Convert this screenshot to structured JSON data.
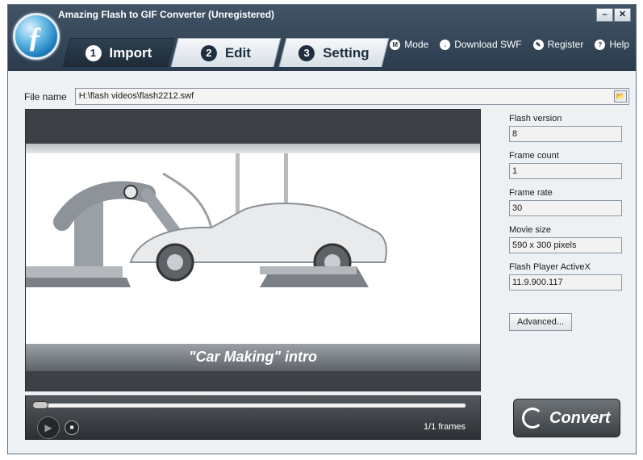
{
  "app": {
    "title": "Amazing Flash to GIF Converter (Unregistered)"
  },
  "window_buttons": {
    "minimize": "–",
    "close": "✕"
  },
  "tabs": [
    {
      "num": "1",
      "label": "Import"
    },
    {
      "num": "2",
      "label": "Edit"
    },
    {
      "num": "3",
      "label": "Setting"
    }
  ],
  "menu": [
    {
      "icon": "M",
      "label": "Mode"
    },
    {
      "icon": "↓",
      "label": "Download SWF"
    },
    {
      "icon": "✎",
      "label": "Register"
    },
    {
      "icon": "?",
      "label": "Help"
    }
  ],
  "file": {
    "label": "File name",
    "value": "H:\\flash videos\\flash2212.swf"
  },
  "preview": {
    "caption": "\"Car Making\" intro"
  },
  "player": {
    "frames": "1/1 frames",
    "progress": 0
  },
  "info": [
    {
      "label": "Flash version",
      "value": "8"
    },
    {
      "label": "Frame count",
      "value": "1"
    },
    {
      "label": "Frame rate",
      "value": "30"
    },
    {
      "label": "Movie size",
      "value": "590 x 300 pixels"
    },
    {
      "label": "Flash Player ActiveX",
      "value": "11.9.900.117"
    }
  ],
  "buttons": {
    "advanced": "Advanced...",
    "convert": "Convert"
  }
}
